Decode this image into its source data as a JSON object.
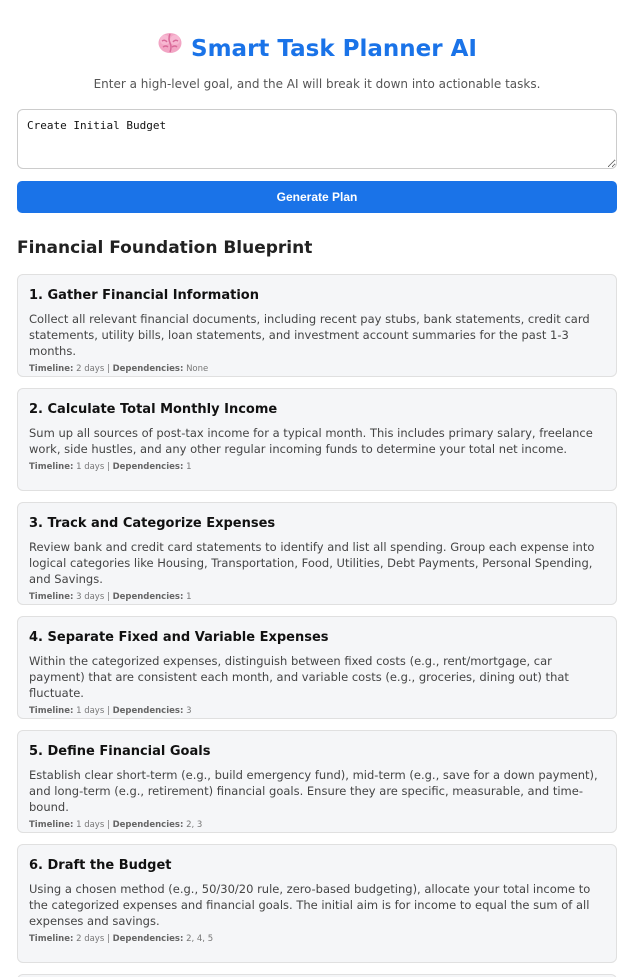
{
  "header": {
    "icon": "brain-icon",
    "title": "Smart Task Planner AI",
    "subtitle": "Enter a high-level goal, and the AI will break it down into actionable tasks."
  },
  "goal_input": {
    "value": "Create Initial Budget",
    "placeholder": ""
  },
  "generate_button": {
    "label": "Generate Plan"
  },
  "plan": {
    "title": "Financial Foundation Blueprint",
    "meta_labels": {
      "timeline": "Timeline:",
      "separator": " | ",
      "dependencies": "Dependencies:"
    },
    "tasks": [
      {
        "title": "1. Gather Financial Information",
        "description": "Collect all relevant financial documents, including recent pay stubs, bank statements, credit card statements, utility bills, loan statements, and investment account summaries for the past 1-3 months.",
        "timeline": "2 days",
        "dependencies": "None"
      },
      {
        "title": "2. Calculate Total Monthly Income",
        "description": "Sum up all sources of post-tax income for a typical month. This includes primary salary, freelance work, side hustles, and any other regular incoming funds to determine your total net income.",
        "timeline": "1 days",
        "dependencies": "1"
      },
      {
        "title": "3. Track and Categorize Expenses",
        "description": "Review bank and credit card statements to identify and list all spending. Group each expense into logical categories like Housing, Transportation, Food, Utilities, Debt Payments, Personal Spending, and Savings.",
        "timeline": "3 days",
        "dependencies": "1"
      },
      {
        "title": "4. Separate Fixed and Variable Expenses",
        "description": "Within the categorized expenses, distinguish between fixed costs (e.g., rent/mortgage, car payment) that are consistent each month, and variable costs (e.g., groceries, dining out) that fluctuate.",
        "timeline": "1 days",
        "dependencies": "3"
      },
      {
        "title": "5. Define Financial Goals",
        "description": "Establish clear short-term (e.g., build emergency fund), mid-term (e.g., save for a down payment), and long-term (e.g., retirement) financial goals. Ensure they are specific, measurable, and time-bound.",
        "timeline": "1 days",
        "dependencies": "2, 3"
      },
      {
        "title": "6. Draft the Budget",
        "description": "Using a chosen method (e.g., 50/30/20 rule, zero-based budgeting), allocate your total income to the categorized expenses and financial goals. The initial aim is for income to equal the sum of all expenses and savings.",
        "timeline": "2 days",
        "dependencies": "2, 4, 5"
      }
    ]
  }
}
